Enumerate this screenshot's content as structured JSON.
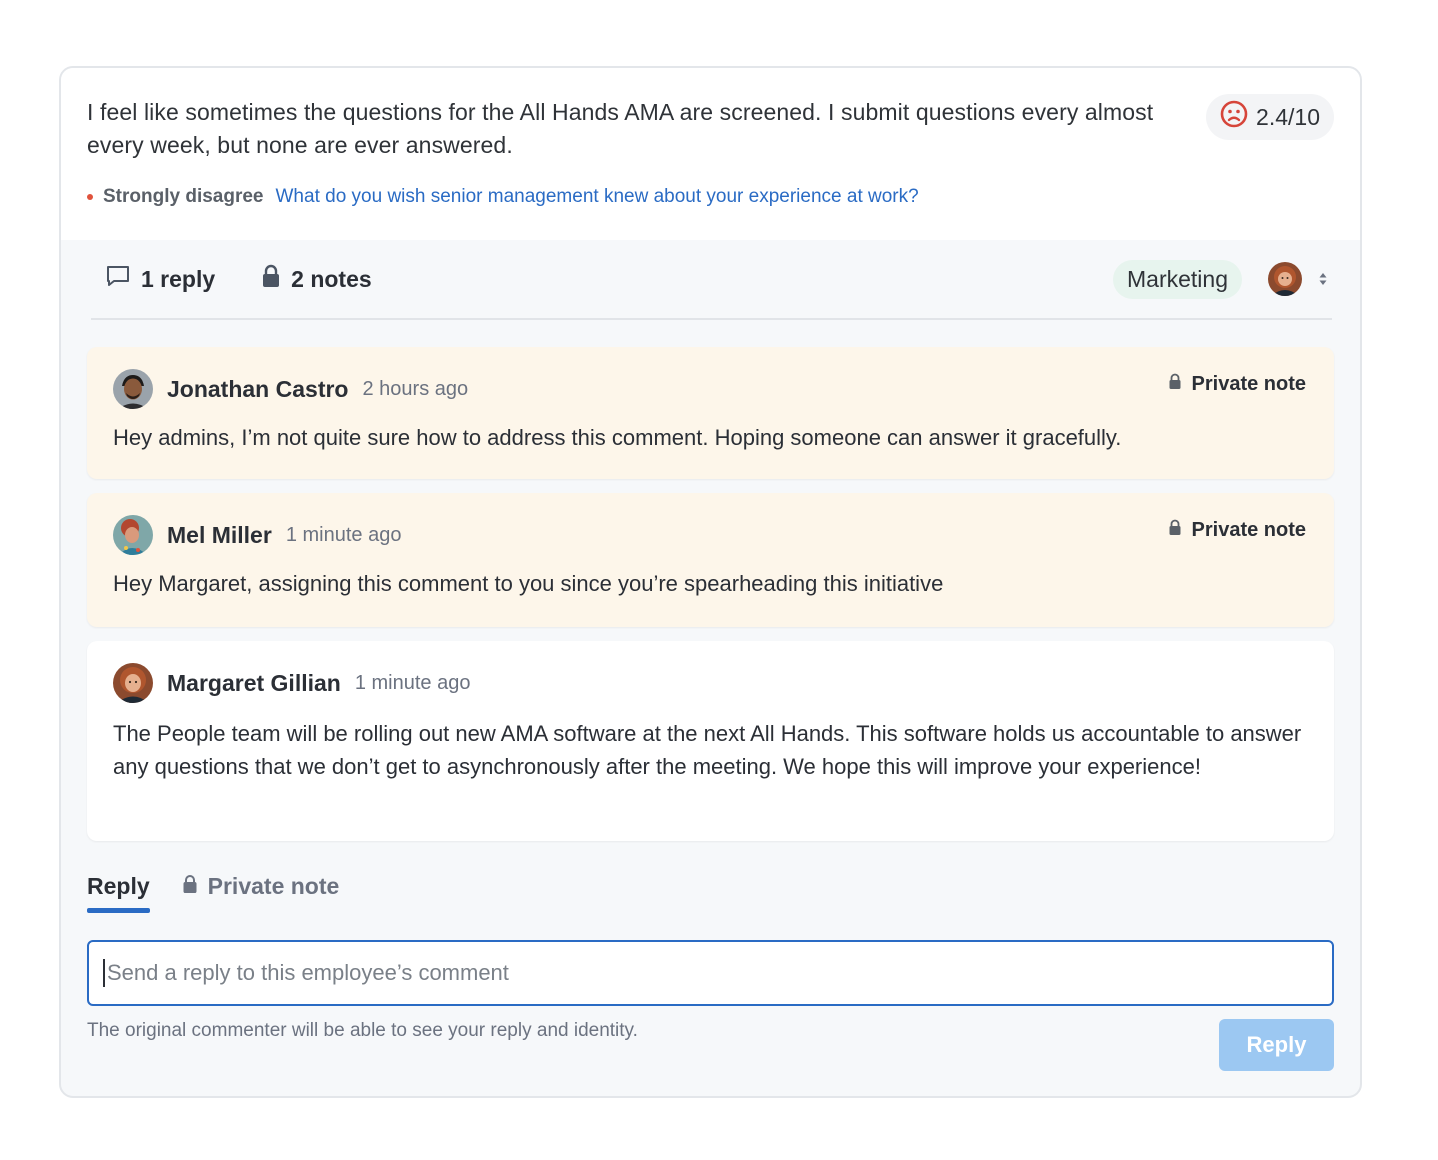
{
  "comment": {
    "text": "I feel like sometimes the questions for the All Hands AMA are screened. I submit questions every almost every week, but none are ever answered.",
    "score": "2.4/10",
    "score_icon": "sad-face-icon",
    "sentiment": "Strongly disagree",
    "question": "What do you wish senior management knew about your experience at work?"
  },
  "stats": {
    "replies": "1 reply",
    "notes": "2 notes",
    "tag": "Marketing"
  },
  "thread": [
    {
      "author": "Jonathan Castro",
      "time": "2 hours ago",
      "private_label": "Private note",
      "body": "Hey admins, I’m not quite sure how to address this comment. Hoping someone can answer it gracefully."
    },
    {
      "author": "Mel Miller",
      "time": "1 minute ago",
      "private_label": "Private note",
      "body": "Hey Margaret, assigning this comment to you since you’re spearheading this initiative"
    },
    {
      "author": "Margaret Gillian",
      "time": "1 minute ago",
      "body": "The People team will be rolling out new AMA software at the next All Hands. This software holds us accountable to answer any questions that we don’t get to asynchronously after the meeting. We hope this will improve your experience!"
    }
  ],
  "composer": {
    "tabs": [
      "Reply",
      "Private note"
    ],
    "active_tab": "Reply",
    "placeholder": "Send a reply to this employee’s comment",
    "hint": "The original commenter will be able to see your reply and identity.",
    "submit_label": "Reply"
  },
  "colors": {
    "accent": "#2a6bc4",
    "private_bg": "#fdf6ea",
    "tag_bg": "#e7f4ee",
    "sad": "#d6453a",
    "button_disabled": "#9cc8f2"
  }
}
